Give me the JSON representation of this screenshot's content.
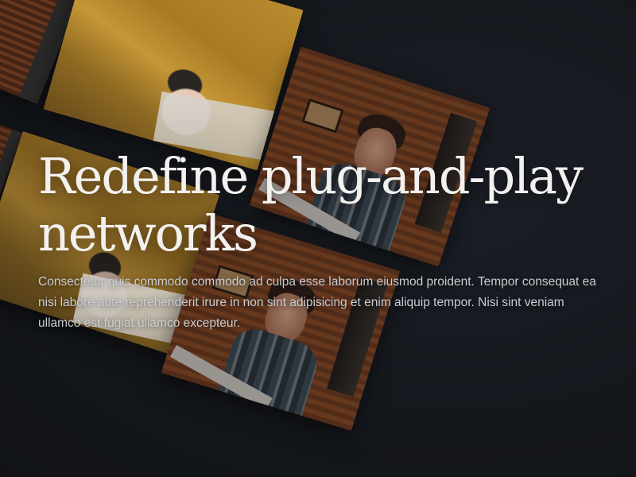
{
  "hero": {
    "title": "Redefine plug-and-play networks",
    "body": "Consectetur quis commodo commodo ad culpa esse laborum eiusmod proident. Tempor consequat ea nisi labore aute reprehenderit irure in non sint adipisicing et enim aliquip tempor. Nisi sint veniam ullamco est fugiat ullamco excepteur."
  },
  "theme": {
    "background": "#14171c",
    "title_color": "#f3f1ee",
    "body_color": "#c9ccd2"
  }
}
